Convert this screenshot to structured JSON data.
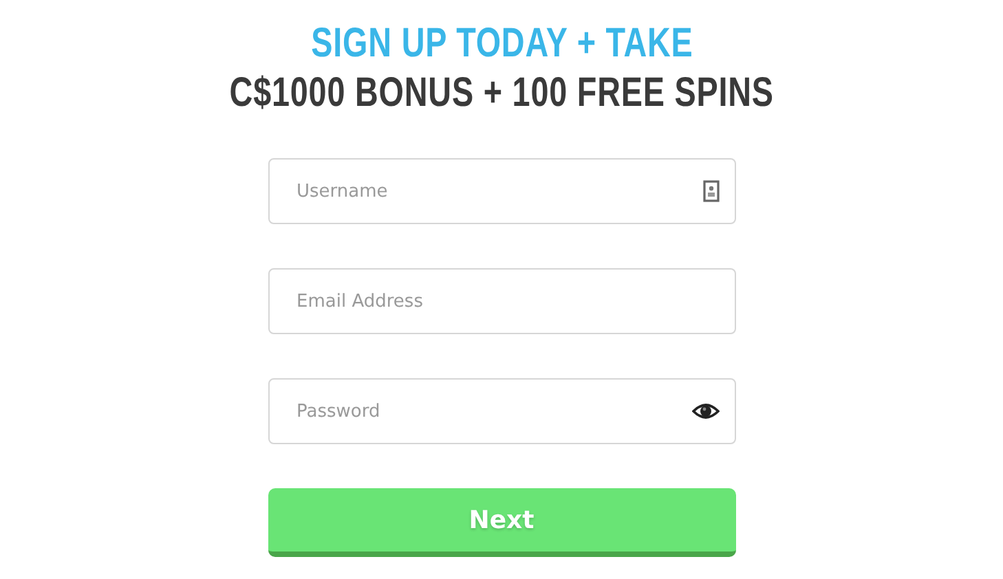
{
  "headline": {
    "line_1": "SIGN UP TODAY + TAKE",
    "line_2": "C$1000 BONUS + 100 FREE SPINS"
  },
  "fields": [
    {
      "placeholder": "Username",
      "kind": "id-card"
    },
    {
      "placeholder": "Email Address",
      "kind": "plain"
    },
    {
      "placeholder": "Password",
      "kind": "reveal"
    }
  ],
  "button": "Next"
}
